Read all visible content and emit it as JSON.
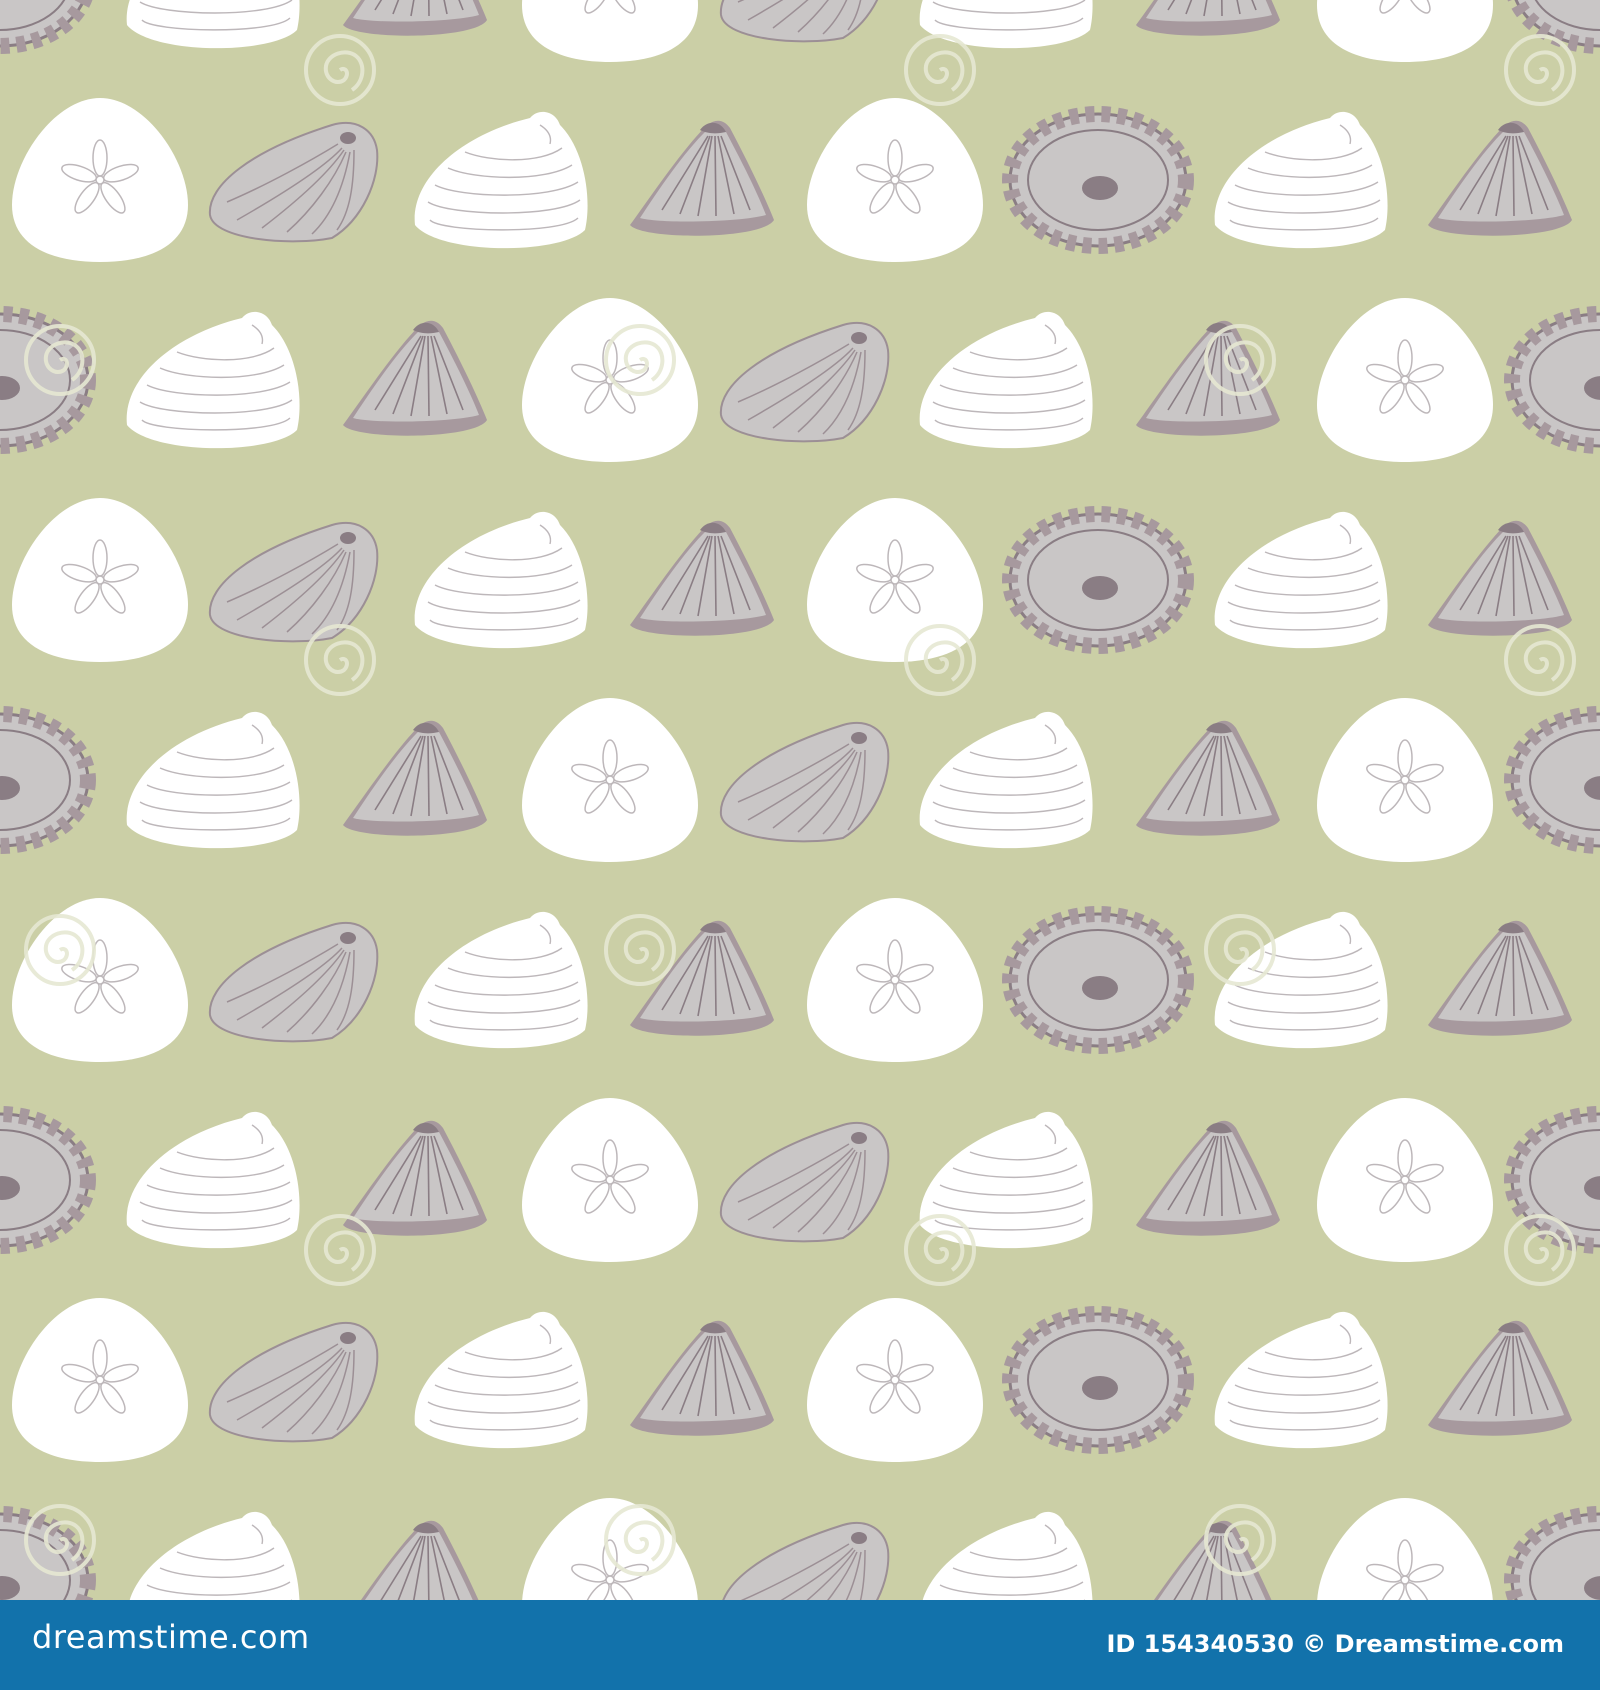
{
  "image": {
    "description_role": "seamless seashell pattern stock image",
    "background_color": "#cbcfa6",
    "shell_colors": {
      "white": "#ffffff",
      "gray_light": "#c9c6c6",
      "gray_dark": "#a7999e",
      "line": "#8a7d84"
    },
    "watermark": {
      "text": "dreamstime",
      "color": "#e6e8d3"
    }
  },
  "footer": {
    "background": "#1272ab",
    "logo_text": "dreamstime.com",
    "credit_text": "ID 154340530 © Dreamstime.com"
  }
}
